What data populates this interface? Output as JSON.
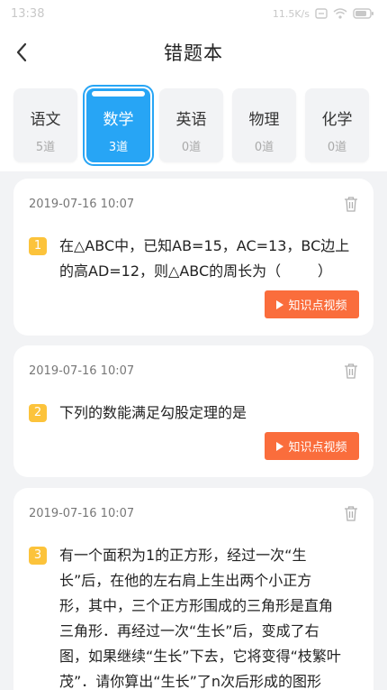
{
  "status_bar": {
    "time": "13:38",
    "net_speed": "11.5K/s"
  },
  "header": {
    "title": "错题本"
  },
  "tabs": [
    {
      "label": "语文",
      "count": "5道",
      "active": false
    },
    {
      "label": "数学",
      "count": "3道",
      "active": true
    },
    {
      "label": "英语",
      "count": "0道",
      "active": false
    },
    {
      "label": "物理",
      "count": "0道",
      "active": false
    },
    {
      "label": "化学",
      "count": "0道",
      "active": false
    }
  ],
  "questions": [
    {
      "number": "1",
      "date": "2019-07-16 10:07",
      "text": "在△ABC中，已知AB=15，AC=13，BC边上\n的高AD=12，则△ABC的周长为（        ）",
      "video_label": "知识点视频"
    },
    {
      "number": "2",
      "date": "2019-07-16 10:07",
      "text": "下列的数能满足勾股定理的是",
      "video_label": "知识点视频"
    },
    {
      "number": "3",
      "date": "2019-07-16 10:07",
      "text": "有一个面积为1的正方形，经过一次“生\n长”后，在他的左右肩上生出两个小正方\n形，其中，三个正方形围成的三角形是直角\n三角形．再经过一次“生长”后，变成了右\n图，如果继续“生长”下去，它将变得“枝繁叶\n茂”．请你算出“生长”了n次后形成的图形\n中所有正方形的面积和是（        ）"
    }
  ],
  "colors": {
    "accent": "#27a5f5",
    "number_badge": "#fcc33b",
    "video_button": "#fa6d3c",
    "background": "#f2f3f5"
  },
  "icons": {
    "back": "chevron-left-icon",
    "delete": "trash-icon",
    "video": "play-icon"
  }
}
